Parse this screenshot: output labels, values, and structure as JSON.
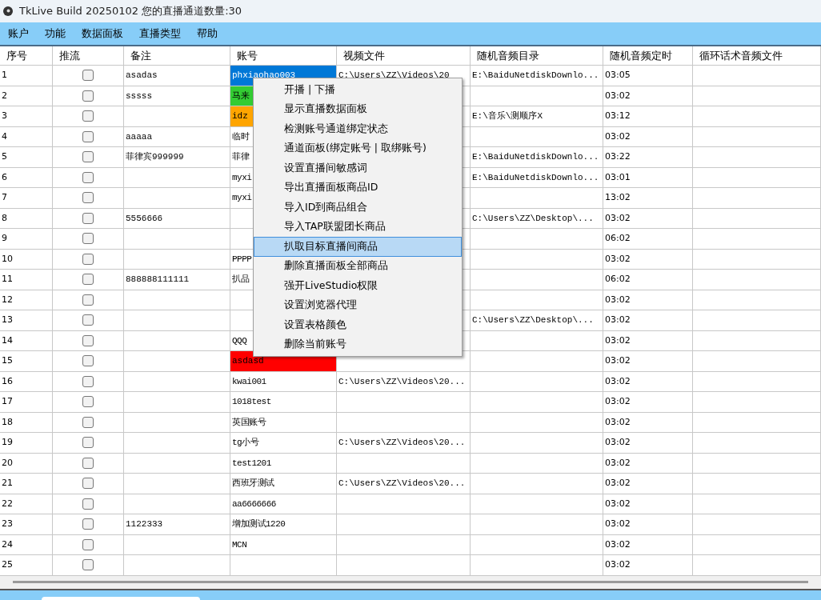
{
  "window": {
    "title": "TkLive  Build 20250102 您的直播通道数量:30"
  },
  "menu_bar": [
    "账户",
    "功能",
    "数据面板",
    "直播类型",
    "帮助"
  ],
  "table": {
    "columns": [
      "序号",
      "推流",
      "备注",
      "账号",
      "视频文件",
      "随机音频目录",
      "随机音频定时",
      "循环话术音频文件"
    ],
    "rows": [
      {
        "number": "1",
        "checked": false,
        "note": "asadas",
        "account": "phxiaohao003",
        "color": "#0078d7",
        "video": "C:\\Users\\ZZ\\Videos\\20",
        "audio_dir": "E:\\BaiduNetdiskDownlo...",
        "timer": "03:05"
      },
      {
        "number": "2",
        "checked": false,
        "note": "sssss",
        "account": "马来",
        "color": "#33cc33",
        "timer": "03:02"
      },
      {
        "number": "3",
        "checked": false,
        "account": "idz",
        "color": "#ffa500",
        "audio_dir": "E:\\音乐\\测顺序X",
        "timer": "03:12"
      },
      {
        "number": "4",
        "checked": false,
        "note": "aaaaa",
        "account": "临时",
        "timer": "03:02"
      },
      {
        "number": "5",
        "checked": false,
        "note": "菲律宾999999",
        "account": "菲律",
        "audio_dir": "E:\\BaiduNetdiskDownlo...",
        "timer": "03:22"
      },
      {
        "number": "6",
        "checked": false,
        "account": "myxi",
        "audio_dir": "E:\\BaiduNetdiskDownlo...",
        "timer": "03:01"
      },
      {
        "number": "7",
        "checked": false,
        "account": "myxi",
        "timer": "13:02"
      },
      {
        "number": "8",
        "checked": false,
        "note": "5556666",
        "audio_dir": "C:\\Users\\ZZ\\Desktop\\...",
        "timer": "03:02"
      },
      {
        "number": "9",
        "checked": false,
        "timer": "06:02"
      },
      {
        "number": "10",
        "checked": false,
        "account": "PPPP",
        "timer": "03:02"
      },
      {
        "number": "11",
        "checked": false,
        "note": "888888111111",
        "account": "扒品",
        "timer": "06:02"
      },
      {
        "number": "12",
        "checked": false,
        "timer": "03:02"
      },
      {
        "number": "13",
        "checked": false,
        "audio_dir": "C:\\Users\\ZZ\\Desktop\\...",
        "timer": "03:02"
      },
      {
        "number": "14",
        "checked": false,
        "account": "QQQ",
        "timer": "03:02"
      },
      {
        "number": "15",
        "checked": false,
        "account": "asdasd",
        "color": "#ff0000",
        "timer": "03:02"
      },
      {
        "number": "16",
        "checked": false,
        "account": "kwai001",
        "video": "C:\\Users\\ZZ\\Videos\\20...",
        "timer": "03:02"
      },
      {
        "number": "17",
        "checked": false,
        "account": "1018test",
        "timer": "03:02"
      },
      {
        "number": "18",
        "checked": false,
        "account": "英国账号",
        "timer": "03:02"
      },
      {
        "number": "19",
        "checked": false,
        "account": "tg小号",
        "video": "C:\\Users\\ZZ\\Videos\\20...",
        "timer": "03:02"
      },
      {
        "number": "20",
        "checked": false,
        "account": "test1201",
        "timer": "03:02"
      },
      {
        "number": "21",
        "checked": false,
        "account": "西班牙测试",
        "video": "C:\\Users\\ZZ\\Videos\\20...",
        "timer": "03:02"
      },
      {
        "number": "22",
        "checked": false,
        "account": "aa6666666",
        "timer": "03:02"
      },
      {
        "number": "23",
        "checked": false,
        "note": "1122333",
        "account": "增加测试1220",
        "timer": "03:02"
      },
      {
        "number": "24",
        "checked": false,
        "account": "MCN",
        "timer": "03:02"
      },
      {
        "number": "25",
        "checked": false,
        "timer": "03:02"
      }
    ]
  },
  "context_menu": [
    {
      "label": "开播 | 下播",
      "selected": false
    },
    {
      "label": "显示直播数据面板",
      "selected": false
    },
    {
      "label": "检测账号通道绑定状态",
      "selected": false
    },
    {
      "label": "通道面板(绑定账号 | 取绑账号)",
      "selected": false
    },
    {
      "label": "设置直播间敏感词",
      "selected": false
    },
    {
      "label": "导出直播面板商品ID",
      "selected": false
    },
    {
      "label": "导入ID到商品组合",
      "selected": false
    },
    {
      "label": "导入TAP联盟团长商品",
      "selected": false
    },
    {
      "label": "扒取目标直播间商品",
      "selected": true
    },
    {
      "label": "删除直播面板全部商品",
      "selected": false
    },
    {
      "label": "强开LiveStudio权限",
      "selected": false
    },
    {
      "label": "设置浏览器代理",
      "selected": false
    },
    {
      "label": "设置表格颜色",
      "selected": false
    },
    {
      "label": "删除当前账号",
      "selected": false
    }
  ]
}
